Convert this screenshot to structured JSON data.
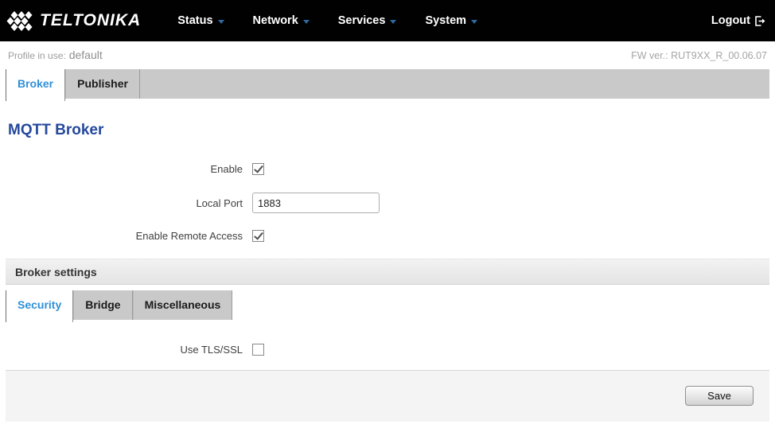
{
  "navbar": {
    "logo_text": "TELTONIKA",
    "items": [
      {
        "label": "Status"
      },
      {
        "label": "Network"
      },
      {
        "label": "Services"
      },
      {
        "label": "System"
      }
    ],
    "logout_label": "Logout"
  },
  "infobar": {
    "profile_label": "Profile in use:",
    "profile_value": "default",
    "fw_version": "FW ver.: RUT9XX_R_00.06.07"
  },
  "tabs": {
    "items": [
      {
        "label": "Broker",
        "active": true
      },
      {
        "label": "Publisher",
        "active": false
      }
    ]
  },
  "page": {
    "title": "MQTT Broker"
  },
  "form": {
    "enable": {
      "label": "Enable",
      "checked": true
    },
    "local_port": {
      "label": "Local Port",
      "value": "1883"
    },
    "remote_access": {
      "label": "Enable Remote Access",
      "checked": true
    }
  },
  "broker_settings": {
    "title": "Broker settings",
    "subtabs": [
      {
        "label": "Security",
        "active": true
      },
      {
        "label": "Bridge",
        "active": false
      },
      {
        "label": "Miscellaneous",
        "active": false
      }
    ],
    "use_tls": {
      "label": "Use TLS/SSL",
      "checked": false
    }
  },
  "footer": {
    "save_label": "Save"
  },
  "colors": {
    "navbar_bg": "#010101",
    "caret_blue": "#2d6a9f",
    "tab_active_text": "#2f90d9",
    "tab_bar_bg": "#c9c9c9",
    "heading_blue": "#26499d",
    "footer_bg": "#f4f4f4"
  }
}
